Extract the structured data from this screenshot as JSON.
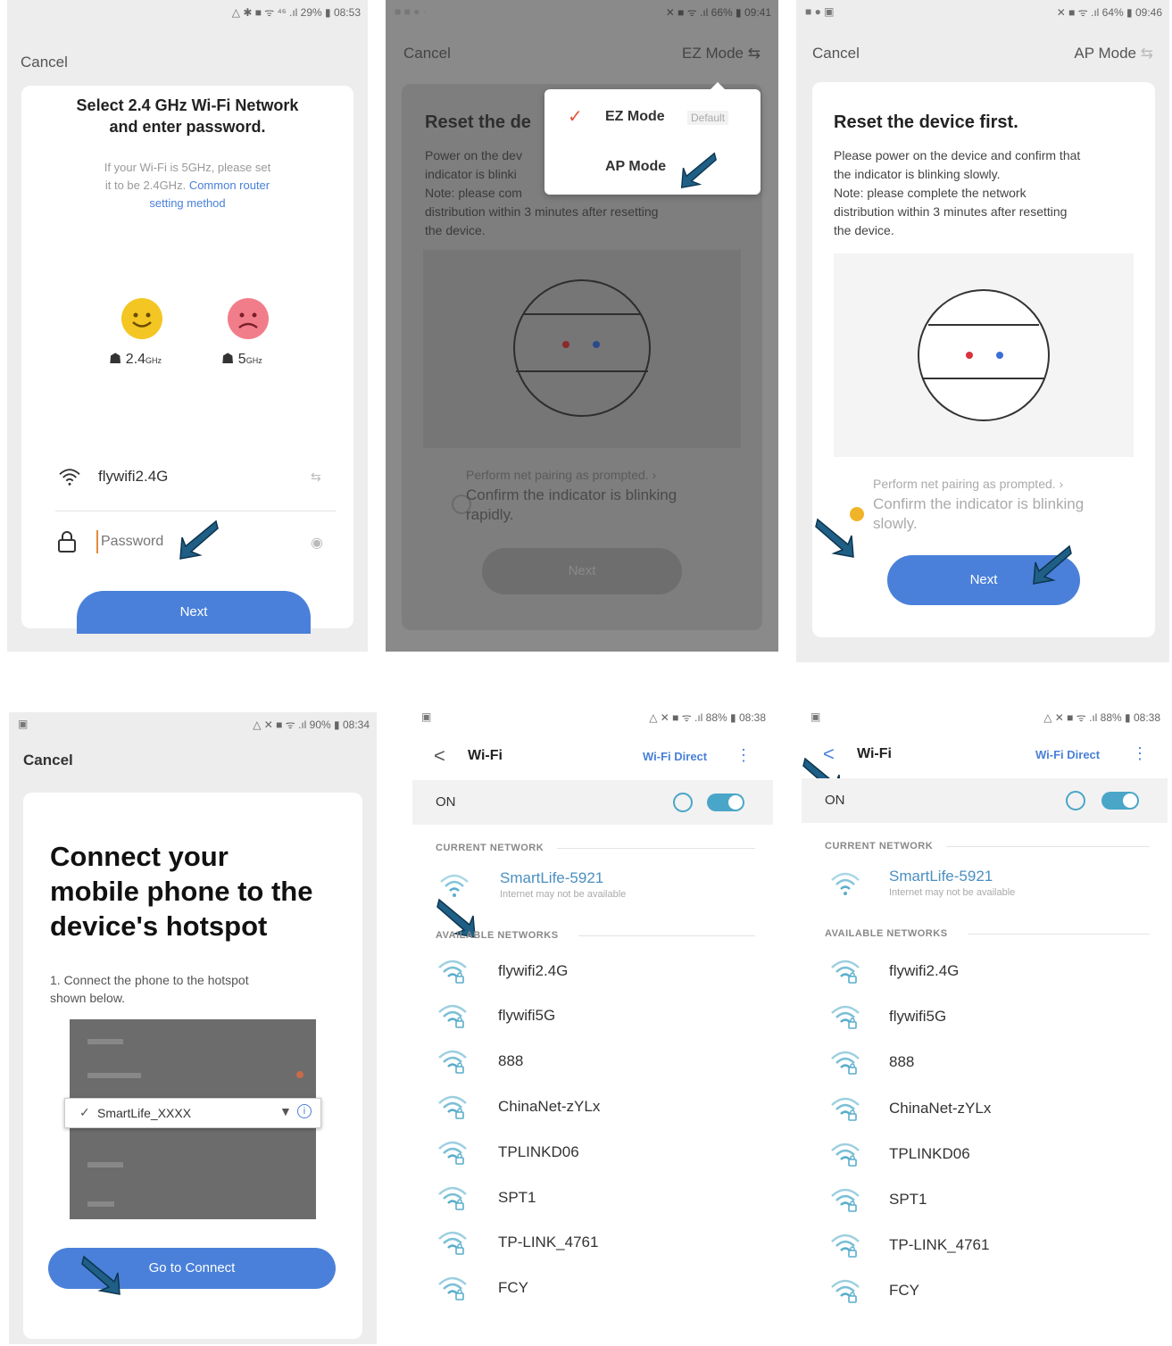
{
  "panel1": {
    "status": "△ ✱ ■ ᯤ ⁴⁶ .ıl 29% ▮ 08:53",
    "cancel": "Cancel",
    "title_line1": "Select 2.4 GHz Wi-Fi Network",
    "title_line2": "and enter password.",
    "note_line1": "If your Wi-Fi is 5GHz, please set",
    "note_line2_plain": "it to be 2.4GHz.",
    "note_line2_link": "Common router",
    "note_line3_link": "setting method",
    "band_24": "2.4",
    "band_24_unit": "GHz",
    "band_5": "5",
    "band_5_unit": "GHz",
    "ssid": "flywifi2.4G",
    "password_placeholder": "Password",
    "next": "Next"
  },
  "panel2": {
    "status": "✕ ■ ᯤ .ıl 66% ▮ 09:41",
    "cancel": "Cancel",
    "mode": "EZ Mode",
    "title": "Reset the de",
    "body_line1": "Power on the dev",
    "body_line2": "indicator is blinki",
    "body_line3": "Note: please com",
    "body_line4": "distribution within 3 minutes after resetting",
    "body_line5": "the device.",
    "menu_ez": "EZ Mode",
    "menu_default": "Default",
    "menu_ap": "AP Mode",
    "prompt": "Perform net pairing as prompted.",
    "confirm_line1": "Confirm the indicator is blinking",
    "confirm_line2": "rapidly.",
    "next": "Next"
  },
  "panel3": {
    "status": "✕ ■ ᯤ .ıl 64% ▮ 09:46",
    "cancel": "Cancel",
    "mode": "AP Mode",
    "title": "Reset the device first.",
    "body_line1": "Please power on the device and confirm that",
    "body_line2": "the indicator is blinking slowly.",
    "body_line3": "Note: please complete the network",
    "body_line4": "distribution within 3 minutes after resetting",
    "body_line5": "the device.",
    "prompt": "Perform net pairing as prompted.",
    "confirm_line1": "Confirm the indicator is blinking",
    "confirm_line2": "slowly.",
    "next": "Next"
  },
  "panel4": {
    "status": "△ ✕ ■ ᯤ .ıl 90% ▮ 08:34",
    "cancel": "Cancel",
    "title_line1": "Connect your",
    "title_line2": "mobile phone to the",
    "title_line3": "device's hotspot",
    "step_line1": "1. Connect the phone to the hotspot",
    "step_line2": "shown below.",
    "hotspot": "SmartLife_XXXX",
    "go": "Go to Connect"
  },
  "wifi_common": {
    "back": "<",
    "title": "Wi-Fi",
    "direct": "Wi-Fi Direct",
    "on": "ON",
    "current_header": "CURRENT NETWORK",
    "current_ssid": "SmartLife-5921",
    "current_sub": "Internet may not be available",
    "available_header": "AVAILABLE NETWORKS",
    "networks": [
      "flywifi2.4G",
      "flywifi5G",
      "888",
      "ChinaNet-zYLx",
      "TPLINKD06",
      "SPT1",
      "TP-LINK_4761",
      "FCY"
    ]
  },
  "panel5": {
    "status": "△ ✕ ■ ᯤ .ıl 88% ▮ 08:38"
  },
  "panel6": {
    "status": "△ ✕ ■ ᯤ .ıl 88% ▮ 08:38"
  },
  "colors": {
    "accent": "#4a80d9",
    "teal": "#4aa6c8",
    "arrow": "#1f5f86",
    "smile": "#f3c623",
    "sad": "#f27d8a"
  }
}
